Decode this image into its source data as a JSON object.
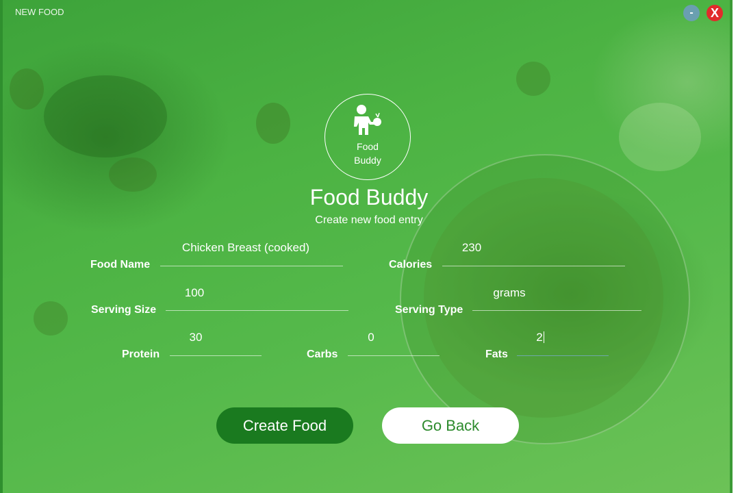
{
  "window": {
    "title": "NEW FOOD",
    "minimize_label": "-",
    "close_label": "X"
  },
  "logo": {
    "line1": "Food",
    "line2": "Buddy"
  },
  "header": {
    "title": "Food Buddy",
    "subtitle": "Create new food entry"
  },
  "form": {
    "food_name": {
      "label": "Food Name",
      "value": "Chicken Breast (cooked)"
    },
    "calories": {
      "label": "Calories",
      "value": "230"
    },
    "serving_size": {
      "label": "Serving Size",
      "value": "100"
    },
    "serving_type": {
      "label": "Serving Type",
      "value": "grams"
    },
    "protein": {
      "label": "Protein",
      "value": "30"
    },
    "carbs": {
      "label": "Carbs",
      "value": "0"
    },
    "fats": {
      "label": "Fats",
      "value": "2"
    }
  },
  "buttons": {
    "create": "Create Food",
    "back": "Go Back"
  },
  "colors": {
    "background": "#4cb343",
    "create_button": "#1a7a1f",
    "close_button": "#e12b2b",
    "minimize_button": "#6a9fb0"
  }
}
